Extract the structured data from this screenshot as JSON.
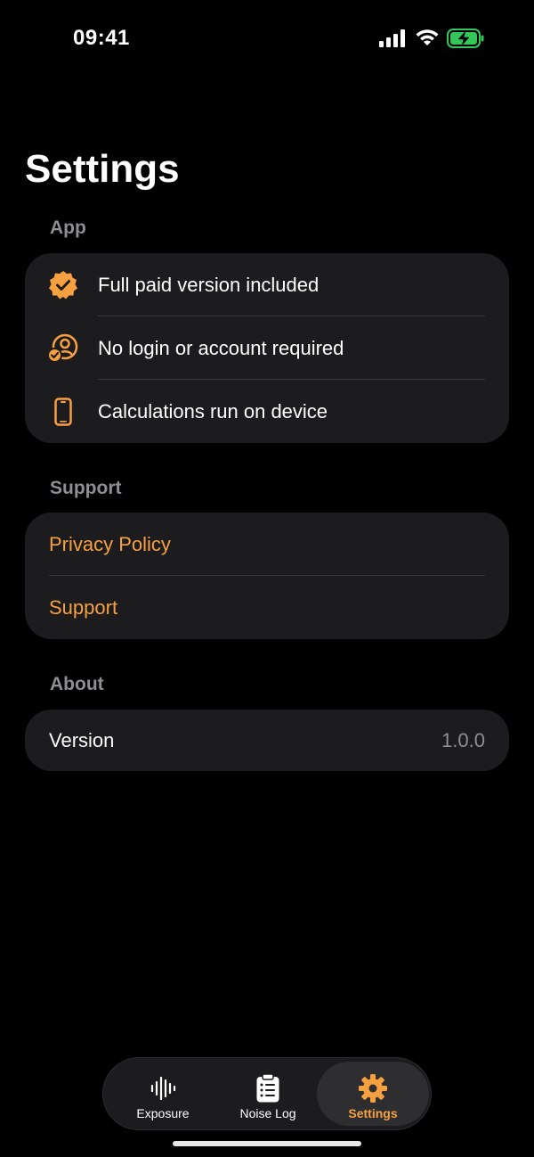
{
  "status_bar": {
    "time": "09:41",
    "icons": [
      "cellular-signal-icon",
      "wifi-icon",
      "battery-charging-icon"
    ]
  },
  "page": {
    "title": "Settings"
  },
  "sections": {
    "app": {
      "header": "App",
      "items": [
        {
          "label": "Full paid version included",
          "icon": "checkmark-seal-icon"
        },
        {
          "label": "No login or account required",
          "icon": "person-check-icon"
        },
        {
          "label": "Calculations run on device",
          "icon": "iphone-icon"
        }
      ]
    },
    "support": {
      "header": "Support",
      "items": [
        {
          "label": "Privacy Policy"
        },
        {
          "label": "Support"
        }
      ]
    },
    "about": {
      "header": "About",
      "items": [
        {
          "label": "Version",
          "value": "1.0.0"
        }
      ]
    }
  },
  "tab_bar": {
    "tabs": [
      {
        "label": "Exposure",
        "icon": "waveform-icon",
        "active": false
      },
      {
        "label": "Noise Log",
        "icon": "clipboard-list-icon",
        "active": false
      },
      {
        "label": "Settings",
        "icon": "gear-icon",
        "active": true
      }
    ]
  },
  "colors": {
    "accent": "#f7a040",
    "background": "#000000",
    "card": "#1c1c1e",
    "secondary_text": "#8e8e93",
    "battery_green": "#34c759"
  }
}
